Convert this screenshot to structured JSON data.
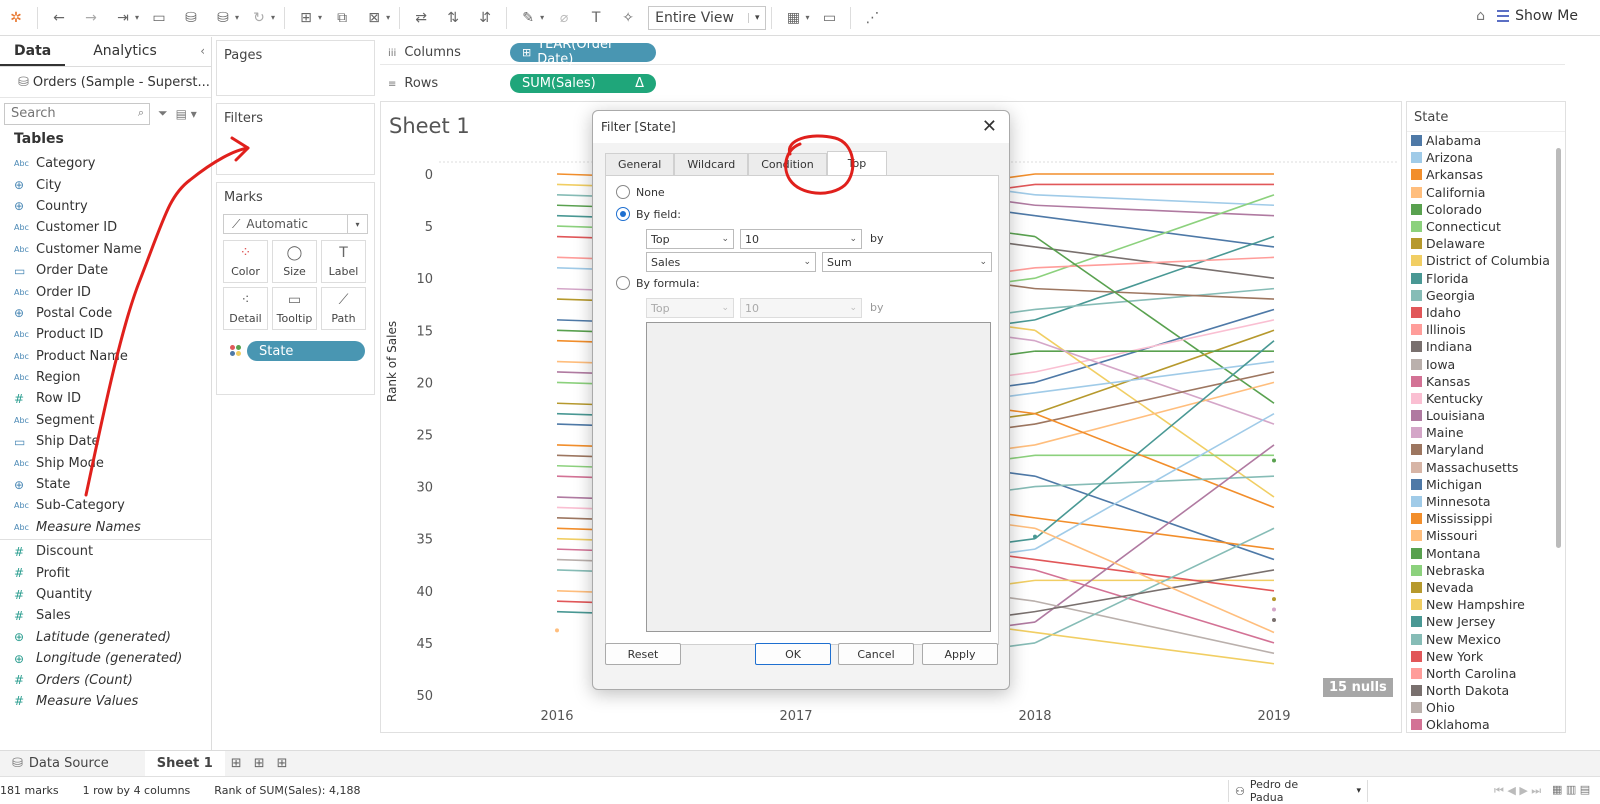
{
  "toolbar": {
    "entire_view": "Entire View",
    "show_me": "Show Me"
  },
  "data_pane": {
    "tab_data": "Data",
    "tab_analytics": "Analytics",
    "datasource": "Orders (Sample - Superst...",
    "search_placeholder": "Search",
    "tables_title": "Tables",
    "dimensions": [
      {
        "type": "Abc",
        "name": "Category"
      },
      {
        "type": "geo",
        "name": "City"
      },
      {
        "type": "geo",
        "name": "Country"
      },
      {
        "type": "Abc",
        "name": "Customer ID"
      },
      {
        "type": "Abc",
        "name": "Customer Name"
      },
      {
        "type": "date",
        "name": "Order Date"
      },
      {
        "type": "Abc",
        "name": "Order ID"
      },
      {
        "type": "geo",
        "name": "Postal Code"
      },
      {
        "type": "Abc",
        "name": "Product ID"
      },
      {
        "type": "Abc",
        "name": "Product Name"
      },
      {
        "type": "Abc",
        "name": "Region"
      },
      {
        "type": "num",
        "name": "Row ID"
      },
      {
        "type": "Abc",
        "name": "Segment"
      },
      {
        "type": "date",
        "name": "Ship Date"
      },
      {
        "type": "Abc",
        "name": "Ship Mode"
      },
      {
        "type": "geo",
        "name": "State"
      },
      {
        "type": "Abc",
        "name": "Sub-Category"
      },
      {
        "type": "Abc",
        "name": "Measure Names",
        "italic": true
      }
    ],
    "measures": [
      {
        "type": "num",
        "name": "Discount"
      },
      {
        "type": "num",
        "name": "Profit"
      },
      {
        "type": "num",
        "name": "Quantity"
      },
      {
        "type": "num",
        "name": "Sales"
      },
      {
        "type": "geo",
        "name": "Latitude (generated)",
        "italic": true
      },
      {
        "type": "geo",
        "name": "Longitude (generated)",
        "italic": true
      },
      {
        "type": "num",
        "name": "Orders (Count)",
        "italic": true
      },
      {
        "type": "num",
        "name": "Measure Values",
        "italic": true
      }
    ]
  },
  "cards": {
    "pages": "Pages",
    "filters": "Filters",
    "marks": "Marks",
    "marks_type": "Automatic",
    "mark_buttons": [
      "Color",
      "Size",
      "Label",
      "Detail",
      "Tooltip",
      "Path"
    ],
    "state_pill": "State"
  },
  "shelves": {
    "columns_label": "Columns",
    "rows_label": "Rows",
    "columns_pill": "YEAR(Order Date)",
    "rows_pill": "SUM(Sales)",
    "rows_pill_delta": "Δ"
  },
  "sheet": {
    "title": "Sheet 1",
    "y_axis_title": "Rank of Sales",
    "nulls": "15 nulls"
  },
  "chart_data": {
    "type": "line",
    "x": [
      "2016",
      "2017",
      "2018",
      "2019"
    ],
    "yticks": [
      "0",
      "5",
      "10",
      "15",
      "20",
      "25",
      "30",
      "35",
      "40",
      "45",
      "50"
    ],
    "ylim": [
      0,
      50
    ],
    "y_reversed": true,
    "ylabel": "Rank of Sales",
    "series_left": [
      {
        "color": "#f28e2b",
        "y2016": 0
      },
      {
        "color": "#f1ce63",
        "y2016": 1
      },
      {
        "color": "#86bcb6",
        "y2016": 2
      },
      {
        "color": "#59a14f",
        "y2016": 3
      },
      {
        "color": "#499894",
        "y2016": 4
      },
      {
        "color": "#8cd17d",
        "y2016": 5
      },
      {
        "color": "#e15759",
        "y2016": 6
      },
      {
        "color": "#ff9d9a",
        "y2016": 8
      },
      {
        "color": "#a0cbe8",
        "y2016": 9
      },
      {
        "color": "#d4a6c8",
        "y2016": 11
      },
      {
        "color": "#b6992d",
        "y2016": 12
      },
      {
        "color": "#4e79a7",
        "y2016": 14
      },
      {
        "color": "#59a14f",
        "y2016": 15
      },
      {
        "color": "#f28e2b",
        "y2016": 16
      },
      {
        "color": "#ffbe7d",
        "y2016": 18
      },
      {
        "color": "#b07aa1",
        "y2016": 19
      },
      {
        "color": "#8cd17d",
        "y2016": 20
      },
      {
        "color": "#b6992d",
        "y2016": 22
      },
      {
        "color": "#499894",
        "y2016": 23
      },
      {
        "color": "#4e79a7",
        "y2016": 24
      },
      {
        "color": "#f28e2b",
        "y2016": 26
      },
      {
        "color": "#9d7660",
        "y2016": 27
      },
      {
        "color": "#8cd17d",
        "y2016": 28
      },
      {
        "color": "#d37295",
        "y2016": 29
      },
      {
        "color": "#b07aa1",
        "y2016": 31
      },
      {
        "color": "#fabfd2",
        "y2016": 32
      },
      {
        "color": "#9d7660",
        "y2016": 33
      },
      {
        "color": "#f28e2b",
        "y2016": 34
      },
      {
        "color": "#f1ce63",
        "y2016": 35
      },
      {
        "color": "#d37295",
        "y2016": 36
      },
      {
        "color": "#bab0ac",
        "y2016": 37
      },
      {
        "color": "#86bcb6",
        "y2016": 38
      },
      {
        "color": "#ffbe7d",
        "y2016": 40
      },
      {
        "color": "#e15759",
        "y2016": 41
      },
      {
        "color": "#499894",
        "y2016": 42
      }
    ],
    "series_right": [
      {
        "color": "#f28e2b",
        "y2018": 0,
        "y2019": 0
      },
      {
        "color": "#e15759",
        "y2018": 1,
        "y2019": 1
      },
      {
        "color": "#a0cbe8",
        "y2018": 2,
        "y2019": 3
      },
      {
        "color": "#b07aa1",
        "y2018": 3,
        "y2019": 4
      },
      {
        "color": "#4e79a7",
        "y2018": 4,
        "y2019": 7
      },
      {
        "color": "#8cd17d",
        "y2018": 10,
        "y2019": 2
      },
      {
        "color": "#79706e",
        "y2018": 7,
        "y2019": 10
      },
      {
        "color": "#499894",
        "y2018": 14,
        "y2019": 6
      },
      {
        "color": "#ff9d9a",
        "y2018": 9,
        "y2019": 8
      },
      {
        "color": "#86bcb6",
        "y2018": 13,
        "y2019": 11
      },
      {
        "color": "#9d7660",
        "y2018": 11,
        "y2019": 12
      },
      {
        "color": "#59a14f",
        "y2018": 6,
        "y2019": 22
      },
      {
        "color": "#4e79a7",
        "y2018": 20,
        "y2019": 13
      },
      {
        "color": "#fabfd2",
        "y2018": 19,
        "y2019": 14
      },
      {
        "color": "#f1ce63",
        "y2018": 15,
        "y2019": 31
      },
      {
        "color": "#b6992d",
        "y2018": 23,
        "y2019": 15
      },
      {
        "color": "#59a14f",
        "y2018": 17,
        "y2019": 17
      },
      {
        "color": "#d4a6c8",
        "y2018": 16,
        "y2019": 24
      },
      {
        "color": "#a0cbe8",
        "y2018": 21,
        "y2019": 18
      },
      {
        "color": "#ffbe7d",
        "y2018": 26,
        "y2019": 20
      },
      {
        "color": "#9d7660",
        "y2018": 24,
        "y2019": 19
      },
      {
        "color": "#8cd17d",
        "y2018": 27,
        "y2019": 27
      },
      {
        "color": "#4e79a7",
        "y2018": 29,
        "y2019": 37
      },
      {
        "color": "#f28e2b",
        "y2018": 23,
        "y2019": 32
      },
      {
        "color": "#86bcb6",
        "y2018": 30,
        "y2019": 29
      },
      {
        "color": "#f28e2b",
        "y2018": 33,
        "y2019": 36
      },
      {
        "color": "#a0cbe8",
        "y2018": 36,
        "y2019": 23
      },
      {
        "color": "#d37295",
        "y2018": 38,
        "y2019": 45
      },
      {
        "color": "#f1ce63",
        "y2018": 39,
        "y2019": 39
      },
      {
        "color": "#e15759",
        "y2018": 37,
        "y2019": 40
      },
      {
        "color": "#b07aa1",
        "y2018": 43,
        "y2019": 26
      },
      {
        "color": "#bab0ac",
        "y2018": 41,
        "y2019": 46
      },
      {
        "color": "#86bcb6",
        "y2018": 45,
        "y2019": 34
      },
      {
        "color": "#f1ce63",
        "y2018": 44,
        "y2019": 47
      },
      {
        "color": "#79706e",
        "y2018": 42,
        "y2019": 38
      },
      {
        "color": "#499894",
        "y2018": 35,
        "y2019": 16
      },
      {
        "color": "#ffbe7d",
        "y2018": 34,
        "y2019": 44
      }
    ]
  },
  "legend": {
    "title": "State",
    "items": [
      {
        "name": "Alabama",
        "color": "#4e79a7"
      },
      {
        "name": "Arizona",
        "color": "#a0cbe8"
      },
      {
        "name": "Arkansas",
        "color": "#f28e2b"
      },
      {
        "name": "California",
        "color": "#ffbe7d"
      },
      {
        "name": "Colorado",
        "color": "#59a14f"
      },
      {
        "name": "Connecticut",
        "color": "#8cd17d"
      },
      {
        "name": "Delaware",
        "color": "#b6992d"
      },
      {
        "name": "District of Columbia",
        "color": "#f1ce63"
      },
      {
        "name": "Florida",
        "color": "#499894"
      },
      {
        "name": "Georgia",
        "color": "#86bcb6"
      },
      {
        "name": "Idaho",
        "color": "#e15759"
      },
      {
        "name": "Illinois",
        "color": "#ff9d9a"
      },
      {
        "name": "Indiana",
        "color": "#79706e"
      },
      {
        "name": "Iowa",
        "color": "#bab0ac"
      },
      {
        "name": "Kansas",
        "color": "#d37295"
      },
      {
        "name": "Kentucky",
        "color": "#fabfd2"
      },
      {
        "name": "Louisiana",
        "color": "#b07aa1"
      },
      {
        "name": "Maine",
        "color": "#d4a6c8"
      },
      {
        "name": "Maryland",
        "color": "#9d7660"
      },
      {
        "name": "Massachusetts",
        "color": "#d7b5a6"
      },
      {
        "name": "Michigan",
        "color": "#4e79a7"
      },
      {
        "name": "Minnesota",
        "color": "#a0cbe8"
      },
      {
        "name": "Mississippi",
        "color": "#f28e2b"
      },
      {
        "name": "Missouri",
        "color": "#ffbe7d"
      },
      {
        "name": "Montana",
        "color": "#59a14f"
      },
      {
        "name": "Nebraska",
        "color": "#8cd17d"
      },
      {
        "name": "Nevada",
        "color": "#b6992d"
      },
      {
        "name": "New Hampshire",
        "color": "#f1ce63"
      },
      {
        "name": "New Jersey",
        "color": "#499894"
      },
      {
        "name": "New Mexico",
        "color": "#86bcb6"
      },
      {
        "name": "New York",
        "color": "#e15759"
      },
      {
        "name": "North Carolina",
        "color": "#ff9d9a"
      },
      {
        "name": "North Dakota",
        "color": "#79706e"
      },
      {
        "name": "Ohio",
        "color": "#bab0ac"
      },
      {
        "name": "Oklahoma",
        "color": "#d37295"
      }
    ]
  },
  "dialog": {
    "title": "Filter [State]",
    "tabs": [
      "General",
      "Wildcard",
      "Condition",
      "Top"
    ],
    "active_tab": "Top",
    "radio_none": "None",
    "radio_by_field": "By field:",
    "radio_by_formula": "By formula:",
    "field_top": "Top",
    "field_count": "10",
    "field_by": "by",
    "field_measure": "Sales",
    "field_agg": "Sum",
    "formula_top": "Top",
    "formula_count": "10",
    "formula_by": "by",
    "btn_reset": "Reset",
    "btn_ok": "OK",
    "btn_cancel": "Cancel",
    "btn_apply": "Apply"
  },
  "bottom": {
    "data_source_tab": "Data Source",
    "sheet_tab": "Sheet 1"
  },
  "status": {
    "marks": "181 marks",
    "rows_cols": "1 row by 4 columns",
    "rank": "Rank of SUM(Sales): 4,188",
    "user": "Pedro de Padua"
  },
  "colors": {
    "dim_pill": "#4996b2",
    "measure_pill": "#1fa67a",
    "annotation": "#e0201c"
  }
}
